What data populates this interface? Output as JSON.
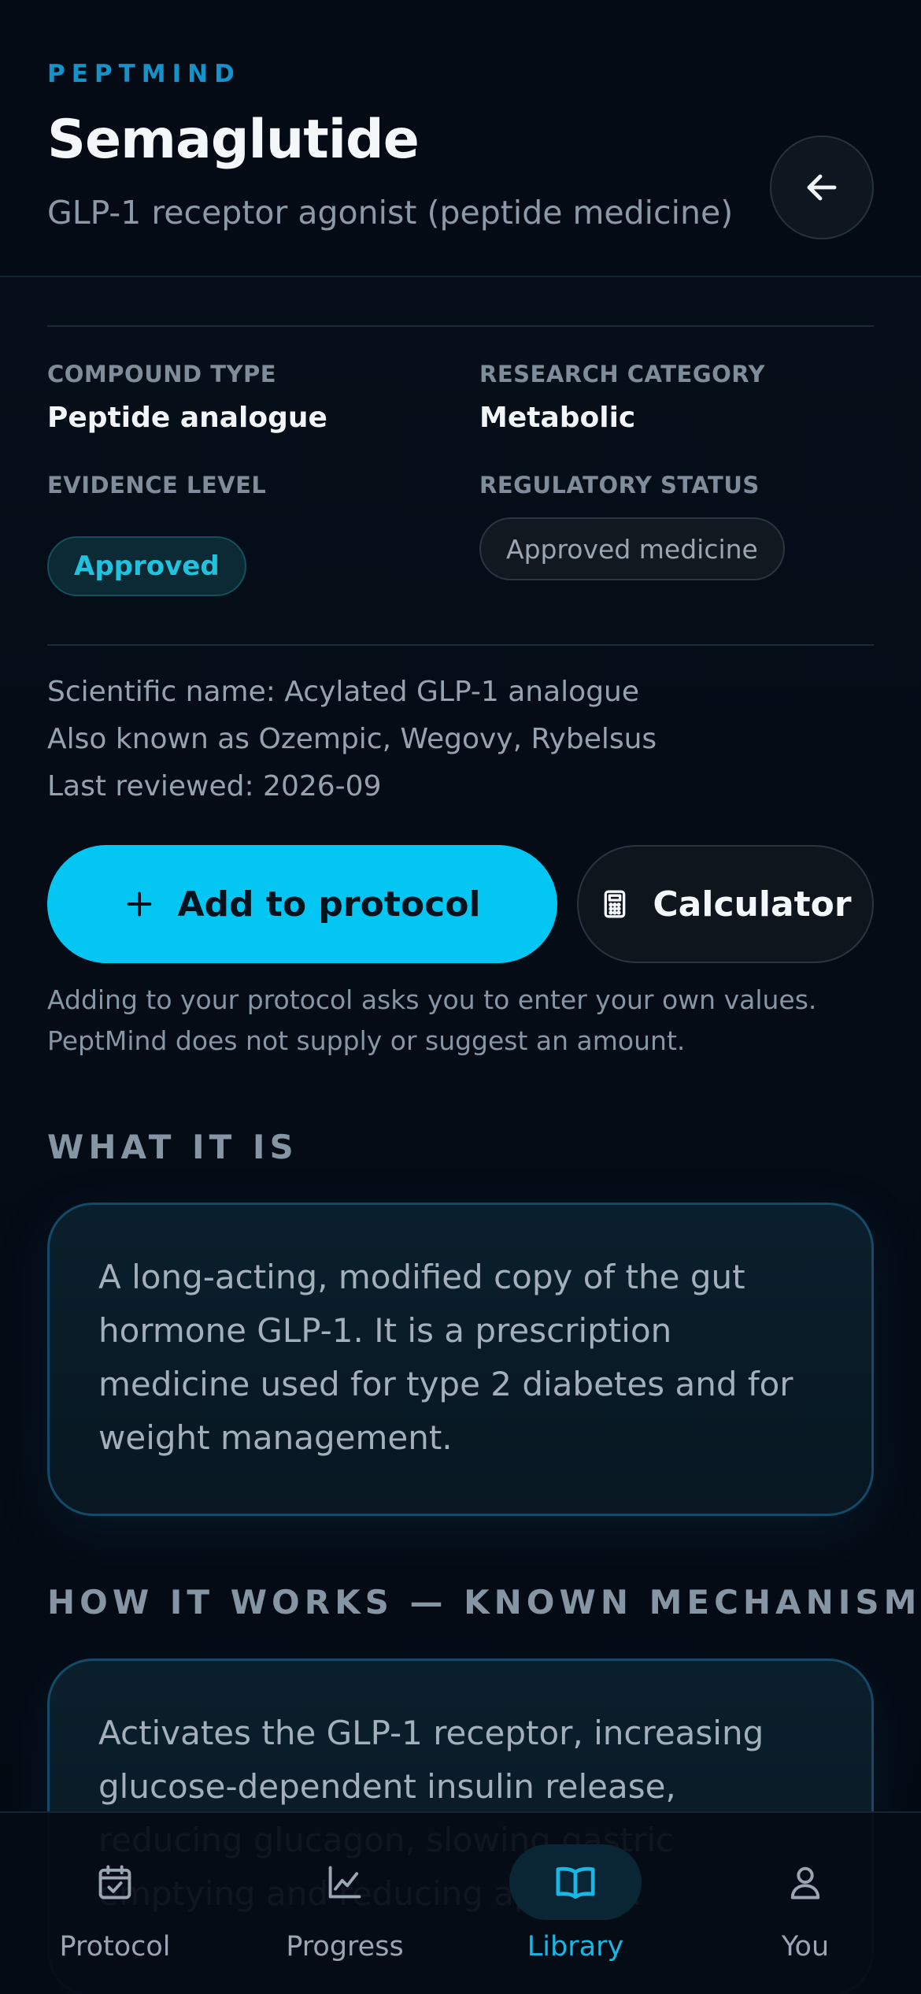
{
  "header": {
    "brand": "PEPTMIND",
    "title": "Semaglutide",
    "subtitle": "GLP-1 receptor agonist (peptide medicine)"
  },
  "details": {
    "compound_type_label": "COMPOUND TYPE",
    "compound_type_value": "Peptide analogue",
    "research_category_label": "RESEARCH CATEGORY",
    "research_category_value": "Metabolic",
    "evidence_level_label": "EVIDENCE LEVEL",
    "evidence_level_value": "Approved",
    "regulatory_status_label": "REGULATORY STATUS",
    "regulatory_status_value": "Approved medicine"
  },
  "meta": {
    "scientific_name": "Scientific name: Acylated GLP-1 analogue",
    "aka": "Also known as Ozempic, Wegovy, Rybelsus",
    "last_reviewed": "Last reviewed: 2026-09"
  },
  "actions": {
    "add_label": "Add to protocol",
    "calculator_label": "Calculator",
    "disclaimer": "Adding to your protocol asks you to enter your own values. PeptMind does not supply or suggest an amount."
  },
  "sections": {
    "what_heading": "WHAT IT IS",
    "what_body": "A long-acting, modified copy of the gut hormone GLP-1. It is a prescription medicine used for type 2 diabetes and for weight management.",
    "how_heading": "HOW IT WORKS — KNOWN MECHANISM",
    "how_body": "Activates the GLP-1 receptor, increasing glucose-dependent insulin release, reducing glucagon, slowing gastric emptying and reducing appetite."
  },
  "tabs": [
    {
      "label": "Protocol",
      "icon": "calendar-check-icon",
      "active": false
    },
    {
      "label": "Progress",
      "icon": "line-chart-icon",
      "active": false
    },
    {
      "label": "Library",
      "icon": "open-book-icon",
      "active": true
    },
    {
      "label": "You",
      "icon": "user-icon",
      "active": false
    }
  ],
  "colors": {
    "accent": "#04c6f2",
    "brand": "#1592c9",
    "background": "#050b14",
    "approved_text": "#1fc3e0"
  }
}
